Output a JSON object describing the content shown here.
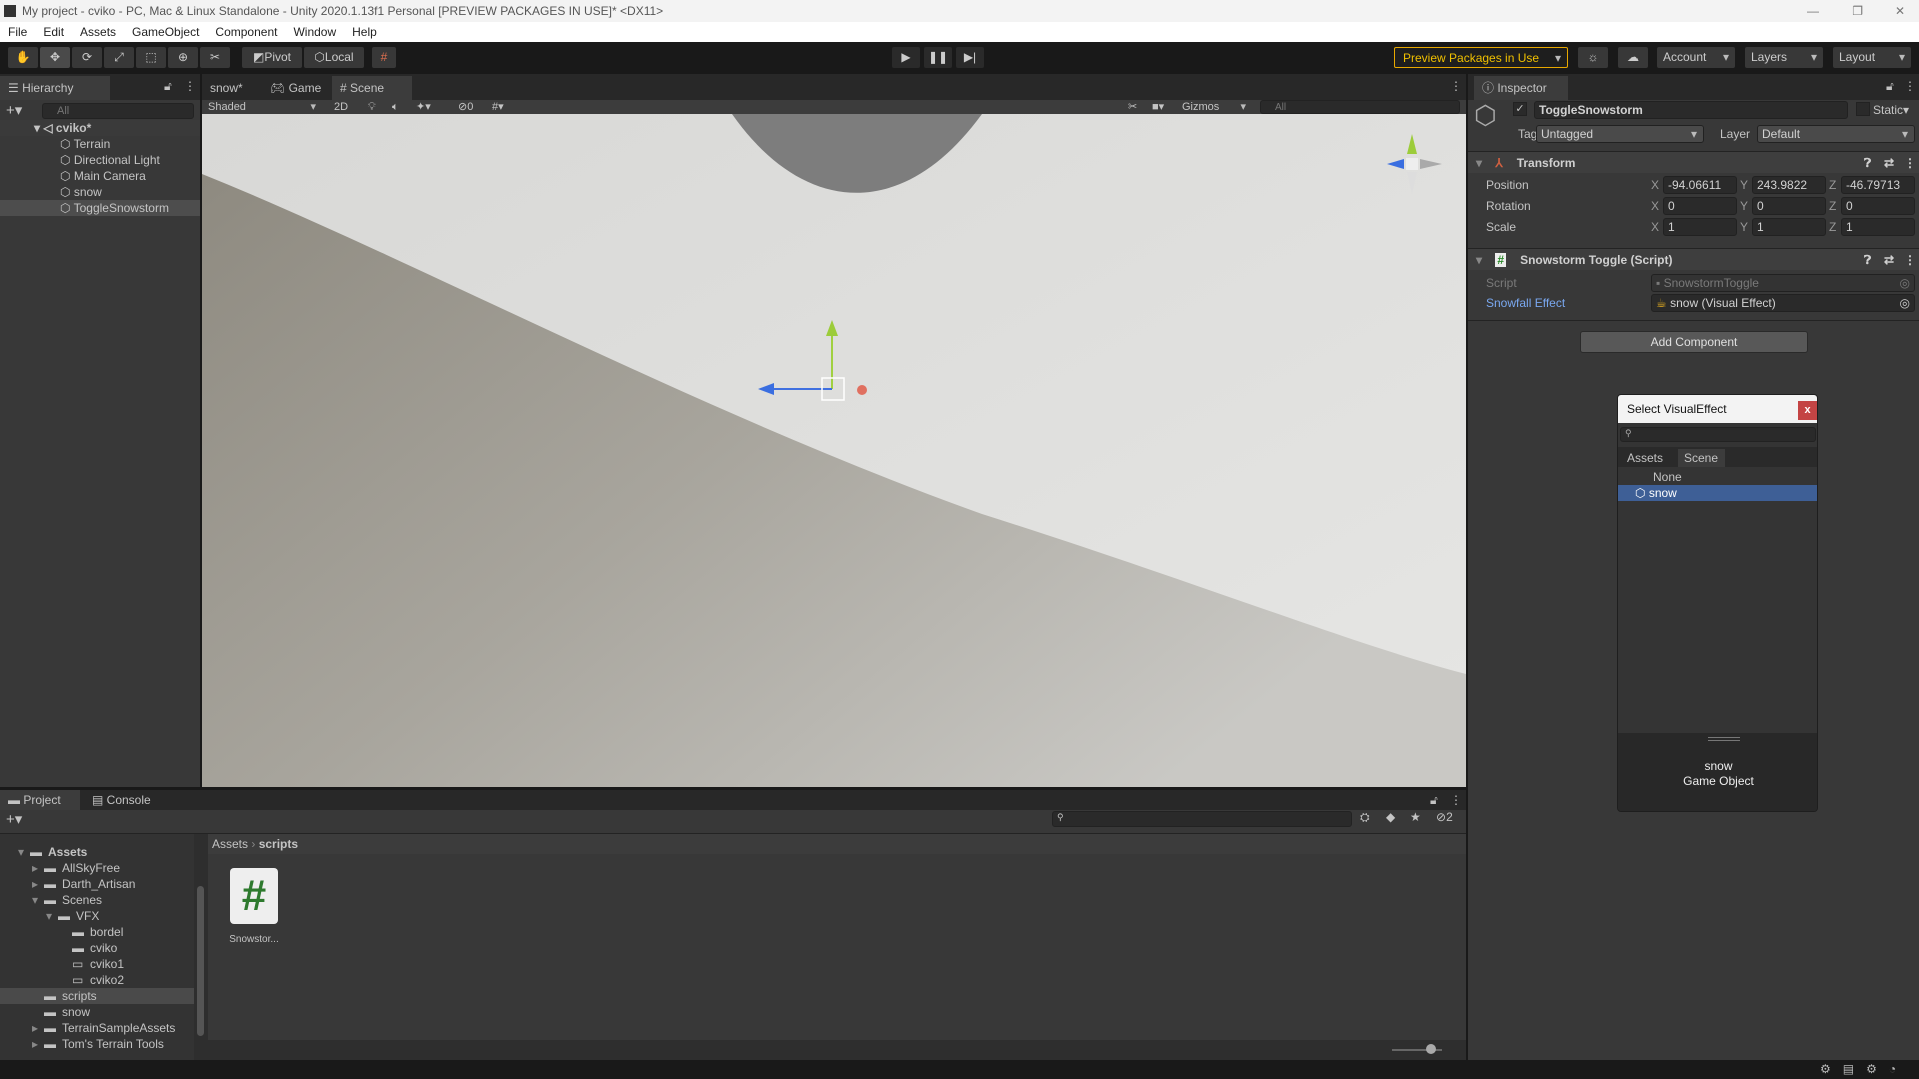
{
  "window": {
    "title": "My project - cviko - PC, Mac & Linux Standalone - Unity 2020.1.13f1 Personal [PREVIEW PACKAGES IN USE]* <DX11>"
  },
  "menu": [
    "File",
    "Edit",
    "Assets",
    "GameObject",
    "Component",
    "Window",
    "Help"
  ],
  "toolbar": {
    "pivot": "Pivot",
    "local": "Local",
    "preview": "Preview Packages in Use",
    "account": "Account",
    "layers": "Layers",
    "layout": "Layout"
  },
  "hierarchy": {
    "tab": "Hierarchy",
    "search_placeholder": "All",
    "scene": "cviko*",
    "items": [
      "Terrain",
      "Directional Light",
      "Main Camera",
      "snow",
      "ToggleSnowstorm"
    ],
    "selected": "ToggleSnowstorm"
  },
  "scene_tabs": [
    "snow*",
    "Game",
    "Scene"
  ],
  "scene_toolbar": {
    "shading": "Shaded",
    "mode2d": "2D",
    "hidden_count": "0",
    "gizmos": "Gizmos",
    "search_placeholder": "All"
  },
  "inspector": {
    "tab": "Inspector",
    "object_name": "ToggleSnowstorm",
    "static": "Static",
    "tag_label": "Tag",
    "tag": "Untagged",
    "layer_label": "Layer",
    "layer": "Default",
    "transform": {
      "title": "Transform",
      "rows": [
        {
          "label": "Position",
          "x": "-94.06611",
          "y": "243.9822",
          "z": "-46.79713"
        },
        {
          "label": "Rotation",
          "x": "0",
          "y": "0",
          "z": "0"
        },
        {
          "label": "Scale",
          "x": "1",
          "y": "1",
          "z": "1"
        }
      ]
    },
    "script": {
      "title": "Snowstorm Toggle (Script)",
      "script_label": "Script",
      "script_value": "SnowstormToggle",
      "effect_label": "Snowfall Effect",
      "effect_value": "snow (Visual Effect)"
    },
    "add_component": "Add Component"
  },
  "picker": {
    "title": "Select VisualEffect",
    "close": "x",
    "tabs": [
      "Assets",
      "Scene"
    ],
    "items": [
      "None",
      "snow"
    ],
    "selected": "snow",
    "preview_name": "snow",
    "preview_type": "Game Object"
  },
  "project": {
    "tabs": [
      "Project",
      "Console"
    ],
    "breadcrumb": [
      "Assets",
      "scripts"
    ],
    "filter_count": "2",
    "tree": [
      {
        "name": "Assets",
        "depth": 0,
        "exp": "open",
        "bold": true
      },
      {
        "name": "AllSkyFree",
        "depth": 1,
        "exp": "closed"
      },
      {
        "name": "Darth_Artisan",
        "depth": 1,
        "exp": "closed"
      },
      {
        "name": "Scenes",
        "depth": 1,
        "exp": "open"
      },
      {
        "name": "VFX",
        "depth": 2,
        "exp": "open"
      },
      {
        "name": "bordel",
        "depth": 3
      },
      {
        "name": "cviko",
        "depth": 3
      },
      {
        "name": "cviko1",
        "depth": 3,
        "empty": true
      },
      {
        "name": "cviko2",
        "depth": 3,
        "empty": true
      },
      {
        "name": "scripts",
        "depth": 1,
        "selected": true
      },
      {
        "name": "snow",
        "depth": 1
      },
      {
        "name": "TerrainSampleAssets",
        "depth": 1,
        "exp": "closed"
      },
      {
        "name": "Tom's Terrain Tools",
        "depth": 1,
        "exp": "closed"
      }
    ],
    "files": [
      {
        "name": "Snowstor...",
        "icon": "csharp-script-icon"
      }
    ]
  },
  "colors": {
    "accent": "#3e5f96",
    "preview_border": "#e8a800",
    "link": "#7aa8f0",
    "close": "#c44444"
  }
}
